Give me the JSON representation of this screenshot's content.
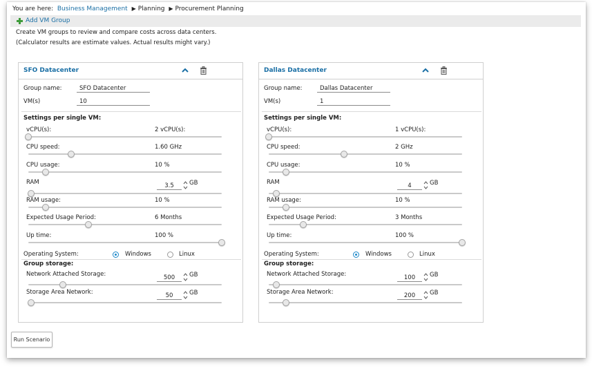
{
  "breadcrumb": {
    "prefix": "You are here:",
    "items": [
      "Business Management",
      "Planning",
      "Procurement Planning"
    ]
  },
  "toolbar": {
    "add_label": "Add VM Group"
  },
  "description": {
    "line1": "Create VM groups to review and compare costs across data centers.",
    "line2": "(Calculator results are estimate values. Actual results might vary.)"
  },
  "labels": {
    "group_name": "Group name:",
    "vms": "VM(s)",
    "settings_title": "Settings per single VM:",
    "vcpus": "vCPU(s):",
    "cpu_speed": "CPU speed:",
    "cpu_usage": "CPU usage:",
    "ram": "RAM",
    "ram_usage": "RAM usage:",
    "usage_period": "Expected Usage Period:",
    "up_time": "Up time:",
    "os": "Operating System:",
    "os_windows": "Windows",
    "os_linux": "Linux",
    "storage_title": "Group storage:",
    "nas": "Network Attached Storage:",
    "san": "Storage Area Network:",
    "gb": "GB"
  },
  "groups": [
    {
      "title": "SFO Datacenter",
      "group_name": "SFO Datacenter",
      "vms": "10",
      "vcpus_text": "2  vCPU(s):",
      "vcpus_level": 0.0,
      "cpu_speed_text": "1.60  GHz",
      "cpu_speed_level": 0.22,
      "cpu_usage_text": "10  %",
      "cpu_usage_level": 0.09,
      "ram_value": "3.5",
      "ram_level": 0.015,
      "ram_usage_text": "10  %",
      "ram_usage_level": 0.09,
      "usage_period_text": "6  Months",
      "usage_period_level": 0.31,
      "up_time_text": "100  %",
      "up_time_level": 1.0,
      "os_selected": "Windows",
      "nas_value": "500",
      "nas_level": 0.18,
      "san_value": "50",
      "san_level": 0.015
    },
    {
      "title": "Dallas Datacenter",
      "group_name": "Dallas Datacenter",
      "vms": "1",
      "vcpus_text": "1  vCPU(s):",
      "vcpus_level": 0.0,
      "cpu_speed_text": "2  GHz",
      "cpu_speed_level": 0.39,
      "cpu_usage_text": "10  %",
      "cpu_usage_level": 0.09,
      "ram_value": "4",
      "ram_level": 0.04,
      "ram_usage_text": "10  %",
      "ram_usage_level": 0.09,
      "usage_period_text": "3  Months",
      "usage_period_level": 0.18,
      "up_time_text": "100  %",
      "up_time_level": 1.0,
      "os_selected": "Windows",
      "nas_value": "100",
      "nas_level": 0.04,
      "san_value": "200",
      "san_level": 0.09
    }
  ],
  "run_button": "Run Scenario",
  "colors": {
    "link": "#1a6fa5",
    "radio_selected": "#1a86c8",
    "add_icon": "#3e9b3a",
    "toolbar_bg": "#ebebeb"
  },
  "icons": [
    "add-icon",
    "collapse-chevron-up-icon",
    "trash-icon",
    "spinner-arrows-icon"
  ]
}
